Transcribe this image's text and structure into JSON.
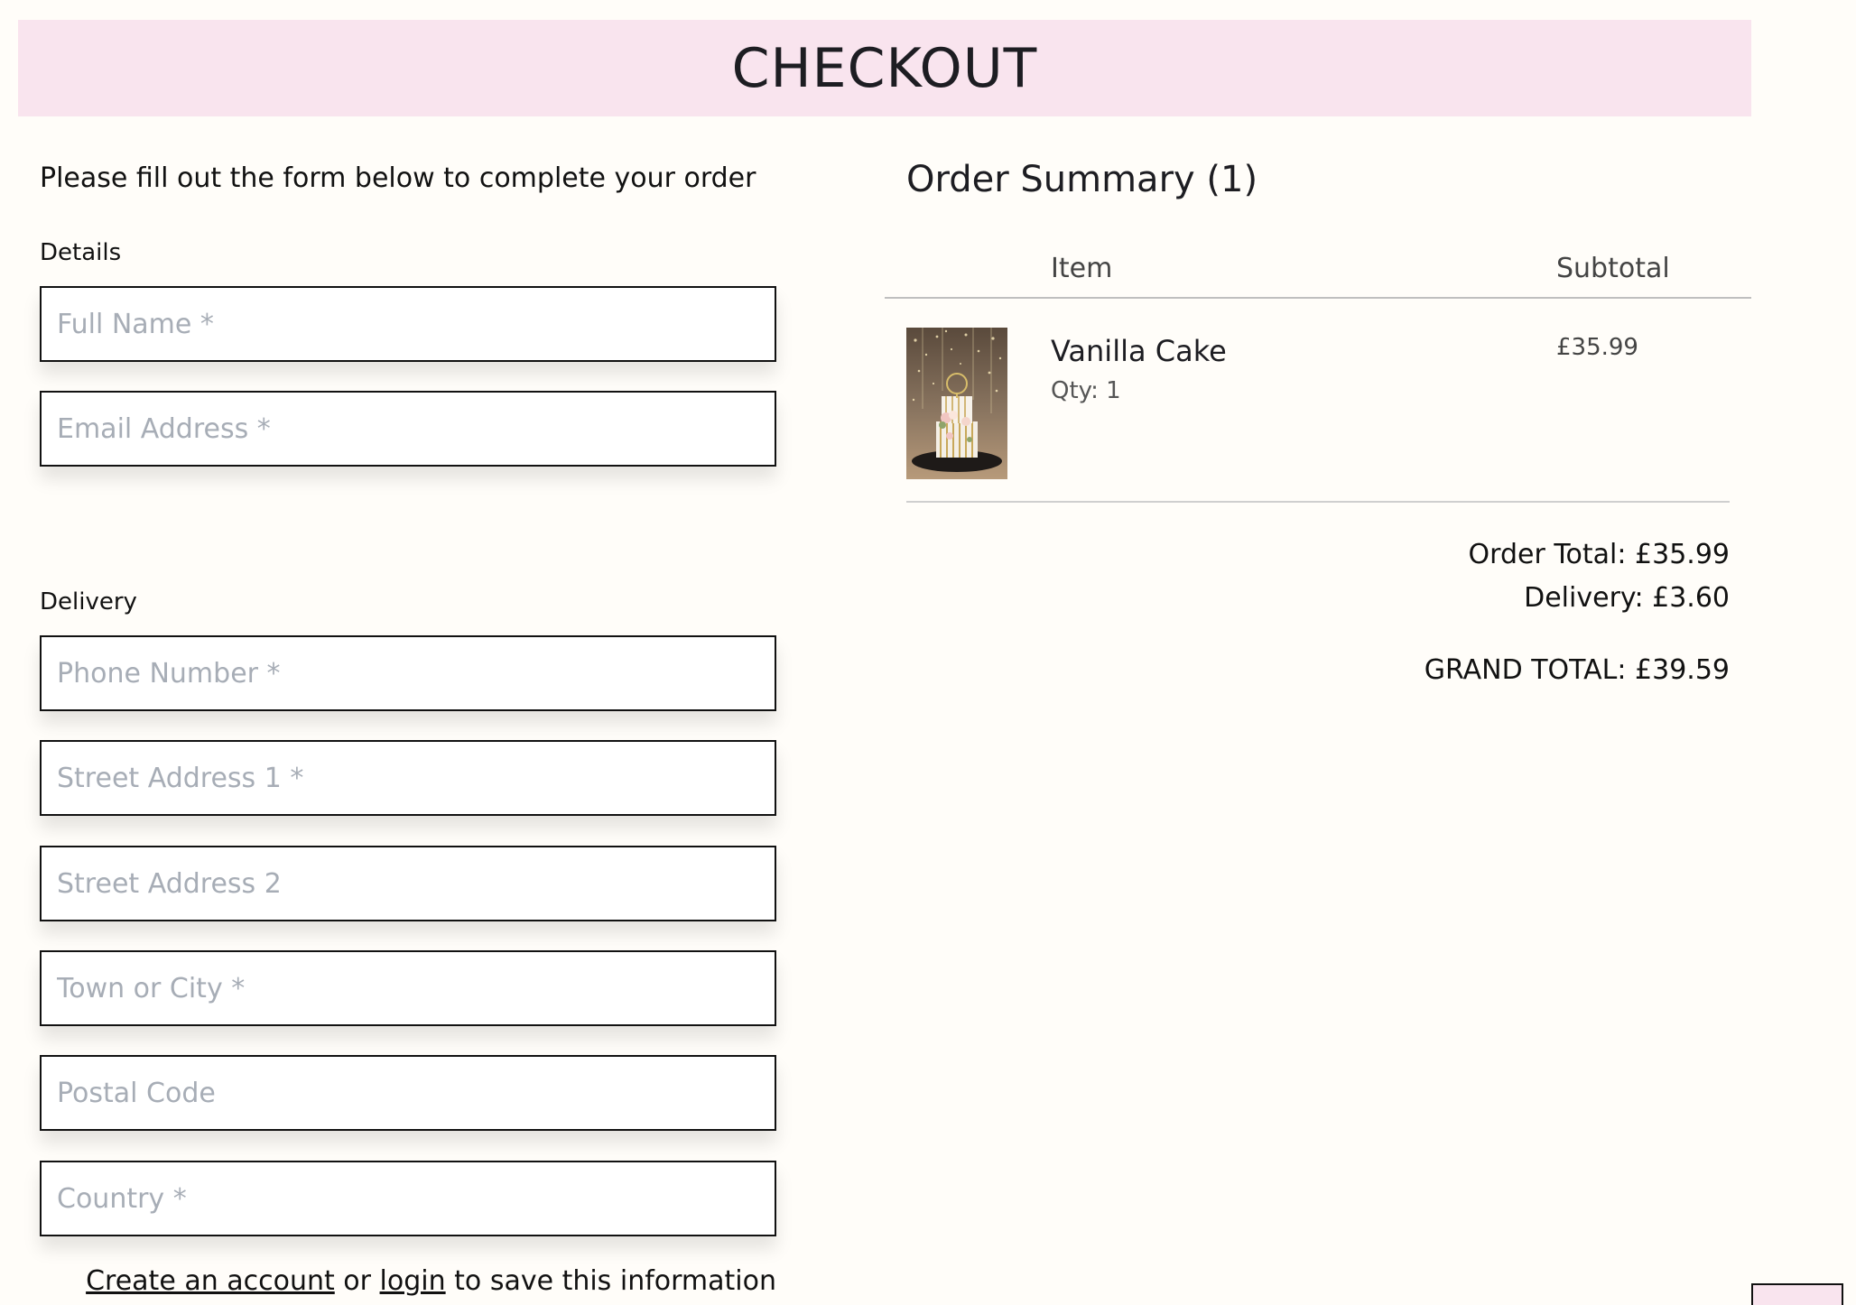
{
  "header": {
    "title": "CHECKOUT"
  },
  "form": {
    "intro": "Please fill out the form below to complete your order",
    "details_label": "Details",
    "delivery_label": "Delivery",
    "fields": {
      "full_name": "Full Name *",
      "email": "Email Address *",
      "phone": "Phone Number *",
      "street1": "Street Address 1 *",
      "street2": "Street Address 2",
      "town": "Town or City *",
      "postal": "Postal Code",
      "country": "Country *"
    },
    "account": {
      "create_link": "Create an account",
      "or_text": " or ",
      "login_link": "login",
      "suffix": " to save this information"
    }
  },
  "summary": {
    "title": "Order Summary (1)",
    "col_item": "Item",
    "col_subtotal": "Subtotal",
    "items": [
      {
        "name": "Vanilla Cake",
        "qty_label": "Qty: 1",
        "price": "£35.99"
      }
    ],
    "order_total": "Order Total: £35.99",
    "delivery": "Delivery: £3.60",
    "grand_total": "GRAND TOTAL: £39.59"
  },
  "colors": {
    "header_bg": "#f9e4ee",
    "page_bg": "#fffdf9",
    "placeholder": "#a7adb6"
  }
}
